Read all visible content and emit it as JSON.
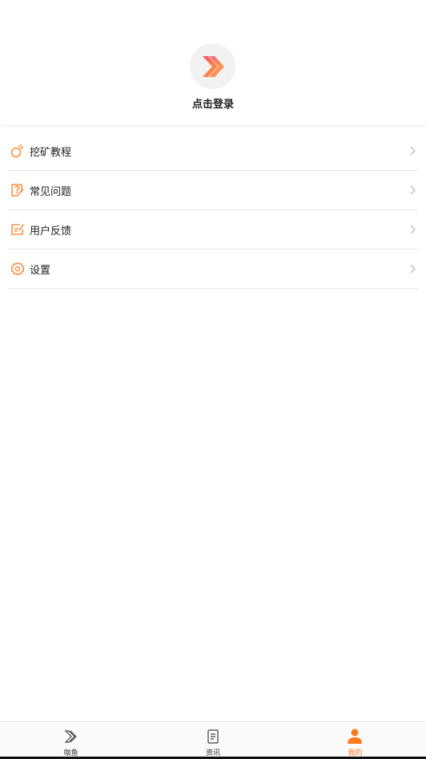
{
  "profile": {
    "login_label": "点击登录"
  },
  "menu": {
    "items": [
      {
        "label": "挖矿教程",
        "icon": "pickaxe-icon"
      },
      {
        "label": "常见问题",
        "icon": "question-doc-icon"
      },
      {
        "label": "用户反馈",
        "icon": "feedback-icon"
      },
      {
        "label": "设置",
        "icon": "gear-icon"
      }
    ]
  },
  "tabbar": {
    "tabs": [
      {
        "label": "咖鱼",
        "icon": "home-logo-icon"
      },
      {
        "label": "资讯",
        "icon": "news-doc-icon"
      },
      {
        "label": "我的",
        "icon": "user-icon"
      }
    ],
    "active_index": 2
  },
  "colors": {
    "accent": "#ff7a1a",
    "brand_gradient_start": "#ff5f6d",
    "brand_gradient_end": "#ffa62b"
  }
}
